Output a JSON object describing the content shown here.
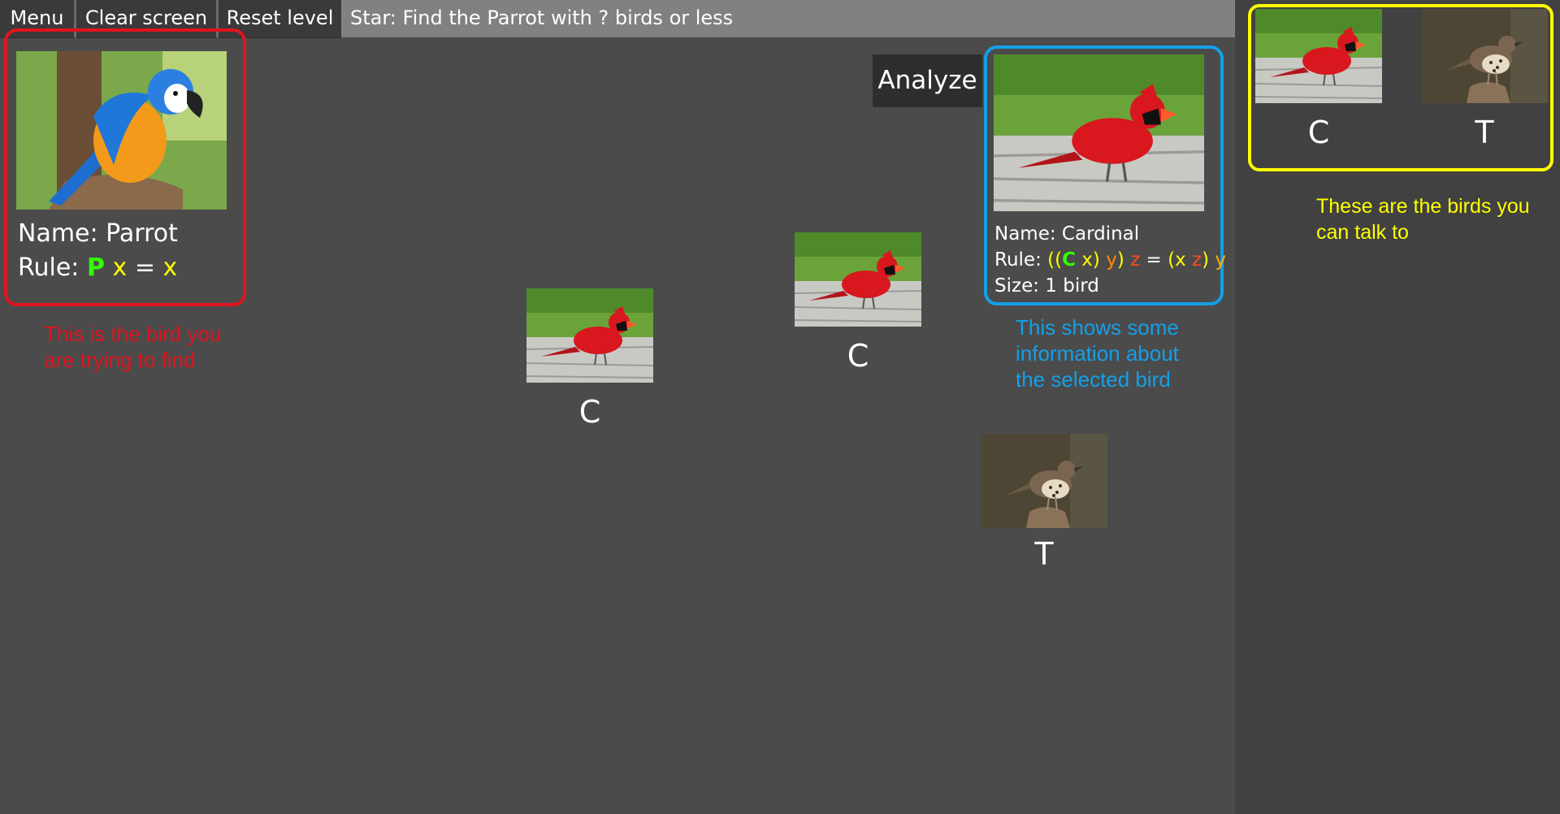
{
  "toolbar": {
    "menu_label": "Menu",
    "clear_label": "Clear screen",
    "reset_label": "Reset level",
    "objective": "Star: Find the Parrot with ? birds or less"
  },
  "target": {
    "name_text": "Name: Parrot",
    "rule_prefix": "Rule: ",
    "rule_p": "P",
    "rule_x1": "x",
    "rule_eq": "=",
    "rule_x2": "x",
    "note": "This is the bird you are trying to find"
  },
  "analyze_label": "Analyze",
  "info": {
    "name_text": "Name: Cardinal",
    "rule_prefix": "Rule: ",
    "rule_parts": [
      "((",
      "C",
      "x",
      ")",
      "y",
      ")",
      "z",
      "=",
      "(",
      "x",
      "z",
      ")",
      "y"
    ],
    "size_text": "Size: 1 bird",
    "note": "This shows some information about the selected bird"
  },
  "canvas_birds": [
    {
      "letter": "C",
      "kind": "cardinal"
    },
    {
      "letter": "C",
      "kind": "cardinal"
    },
    {
      "letter": "T",
      "kind": "thrush"
    }
  ],
  "palette": {
    "title": "These are the birds you can talk to",
    "birds": [
      {
        "letter": "C",
        "kind": "cardinal"
      },
      {
        "letter": "T",
        "kind": "thrush"
      }
    ]
  },
  "colors": {
    "target_border": "#e0141f",
    "info_border": "#13a0e8",
    "palette_border": "#ffff00"
  }
}
